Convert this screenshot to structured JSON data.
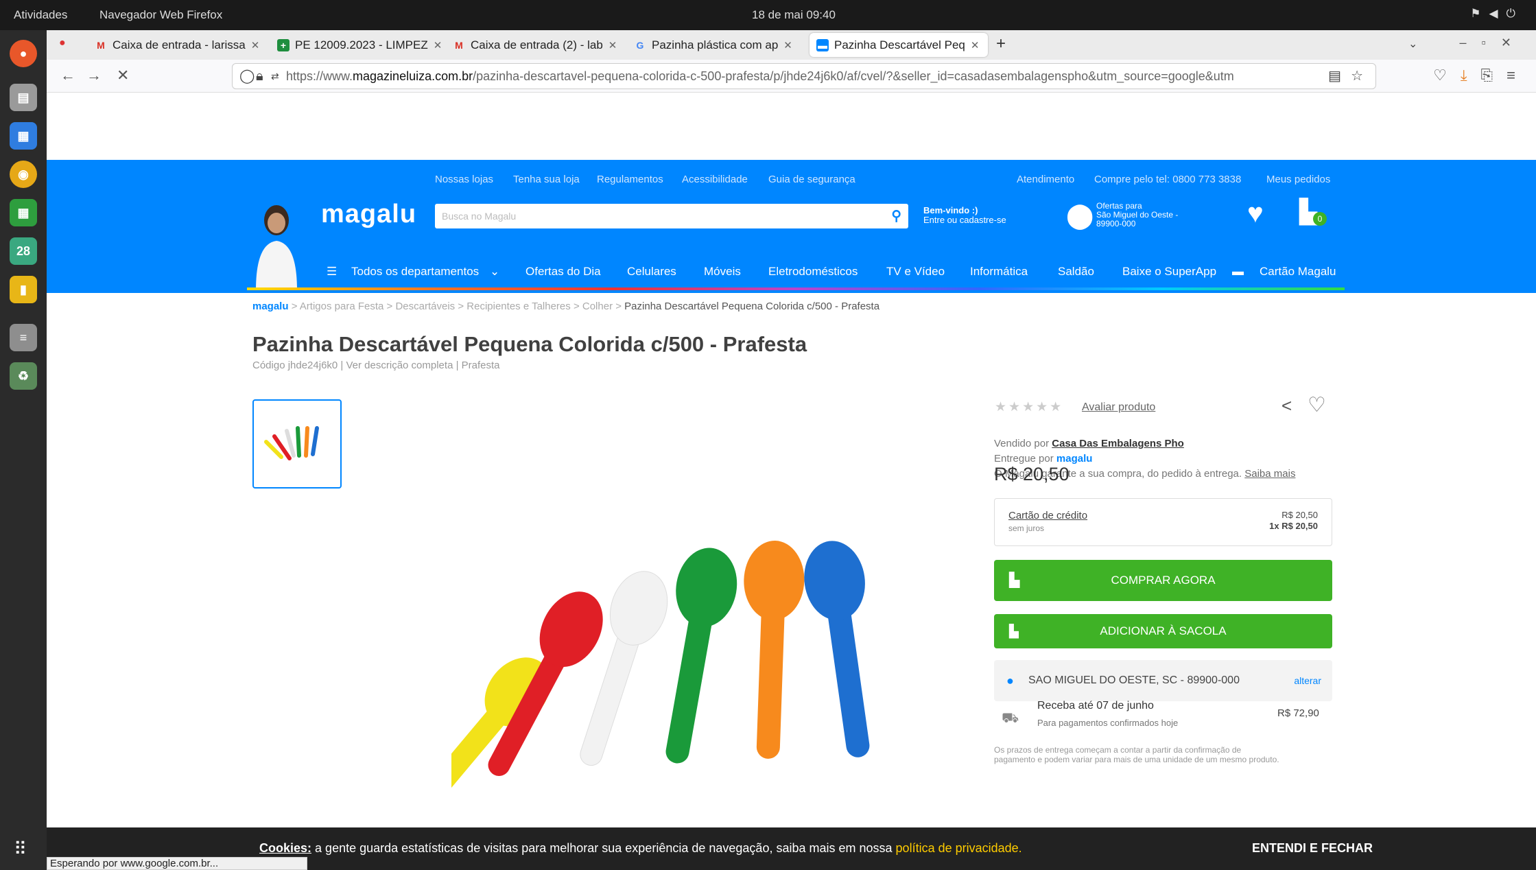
{
  "system": {
    "activities": "Atividades",
    "app_name": "Navegador Web Firefox",
    "clock": "18 de mai 09:40",
    "tray_icons": [
      "network-icon",
      "volume-icon",
      "power-icon"
    ]
  },
  "dock": {
    "items": [
      "firefox-icon",
      "files-icon",
      "writer-icon",
      "chrome-icon",
      "calc-icon",
      "calendar-icon",
      "notes-icon",
      "text-editor-icon",
      "trash-icon",
      "app-grid-icon"
    ],
    "calendar_day": "28"
  },
  "tabs": [
    {
      "label": "Caixa de entrada - larissa",
      "icon": "gmail-icon"
    },
    {
      "label": "PE 12009.2023 - LIMPEZ",
      "icon": "sheets-icon"
    },
    {
      "label": "Caixa de entrada (2) - lab",
      "icon": "gmail-icon"
    },
    {
      "label": "Pazinha plástica com ap",
      "icon": "google-icon"
    },
    {
      "label": "Pazinha Descartável Peq",
      "icon": "magalu-icon",
      "active": true
    }
  ],
  "url": {
    "prefix": "https://www.",
    "domain": "magazineluiza.com.br",
    "path": "/pazinha-descartavel-pequena-colorida-c-500-prafesta/p/jhde24j6k0/af/cvel/?&seller_id=casadasembalagenspho&utm_source=google&utm"
  },
  "header": {
    "top_links_left": [
      "Nossas lojas",
      "Tenha sua loja",
      "Regulamentos",
      "Acessibilidade",
      "Guia de segurança"
    ],
    "top_links_right": [
      "Atendimento",
      "Compre pelo tel: 0800 773 3838",
      "Meus pedidos"
    ],
    "logo": "magalu",
    "search_placeholder": "Busca no Magalu",
    "welcome": "Bem-vindo :)",
    "login": "Entre ou cadastre-se",
    "offers_for": "Ofertas para",
    "city": "São Miguel do Oeste -",
    "cep": "89900-000",
    "cart_count": "0",
    "categories": [
      "Todos os departamentos",
      "Ofertas do Dia",
      "Celulares",
      "Móveis",
      "Eletrodomésticos",
      "TV e Vídeo",
      "Informática",
      "Saldão",
      "Baixe o SuperApp",
      "Cartão Magalu"
    ]
  },
  "breadcrumb": {
    "home": "magalu",
    "items": [
      "Artigos para Festa",
      "Descartáveis",
      "Recipientes e Talheres",
      "Colher"
    ],
    "current": "Pazinha Descartável Pequena Colorida c/500 - Prafesta",
    "sep": ">"
  },
  "product": {
    "title": "Pazinha Descartável Pequena Colorida c/500 - Prafesta",
    "code_line": "Código jhde24j6k0 | Ver descrição completa | Prafesta",
    "rate_link": "Avaliar produto",
    "sold_by_label": "Vendido por",
    "seller": "Casa Das Embalagens Pho",
    "delivered_by": "Entregue por",
    "delivered_brand": "magalu",
    "guarantee": "O Magalu garante a sua compra, do pedido à entrega.",
    "learn_more": "Saiba mais",
    "price": "R$ 20,50",
    "card_label": "Cartão de crédito",
    "card_sub": "sem juros",
    "card_price": "R$ 20,50",
    "card_install": "1x R$ 20,50",
    "buy_now": "COMPRAR AGORA",
    "add_bag": "ADICIONAR À SACOLA",
    "location": "SAO MIGUEL DO OESTE, SC - 89900-000",
    "change": "alterar",
    "delivery_title": "Receba até 07 de junho",
    "delivery_sub": "Para pagamentos confirmados hoje",
    "delivery_price": "R$ 72,90",
    "delivery_note1": "Os prazos de entrega começam a contar a partir da confirmação de",
    "delivery_note2": "pagamento e podem variar para mais de uma unidade de um mesmo produto."
  },
  "colors": {
    "brand": "#0086ff",
    "buy": "#3fb226",
    "spoons": [
      "#f2e21a",
      "#e01f26",
      "#f5f5f5",
      "#1a9a3a",
      "#f78a1d",
      "#1e6fd0"
    ]
  },
  "cookie": {
    "lead": "Cookies:",
    "text": "a gente guarda estatísticas de visitas para melhorar sua experiência de navegação, saiba mais em nossa",
    "link": "política de privacidade.",
    "button": "ENTENDI E FECHAR"
  },
  "status": "Esperando por www.google.com.br..."
}
